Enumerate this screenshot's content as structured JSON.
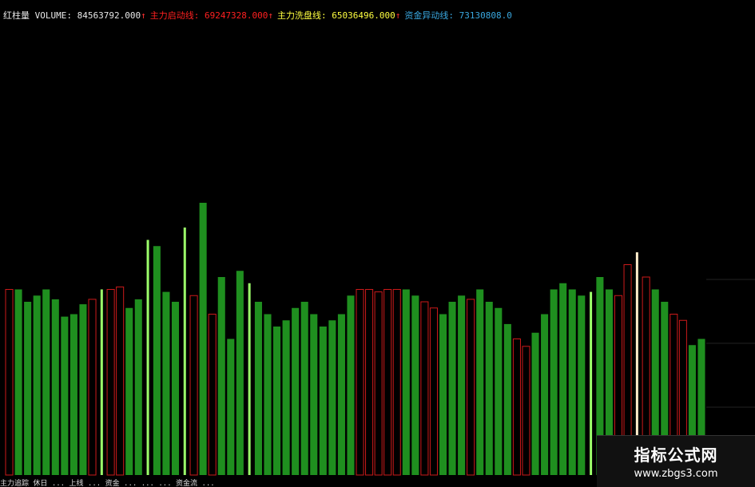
{
  "legend": [
    {
      "label": "红柱量 VOLUME: 84563792.000",
      "arrow": "↑",
      "color": "#e8e8e8"
    },
    {
      "label": "主力启动线: 69247328.000",
      "arrow": "↑",
      "color": "#ff2020"
    },
    {
      "label": "主力洗盘线: 65036496.000",
      "arrow": "↑",
      "color": "#ffff40"
    },
    {
      "label": "资金异动线: 73130808.0",
      "arrow": "",
      "color": "#3aa8e0"
    }
  ],
  "bottom_text": "主力追踪  休日 ...  上线 ...  资金 ...  ...  ...  资金流 ...",
  "watermark": {
    "title": "指标公式网",
    "url": "www.zbgs3.com"
  },
  "colors": {
    "bar_up": "#cc1a1a",
    "bar_down": "#1f8f1f",
    "bar_highlight": "#9cff6a",
    "bar_cream": "#ffeecc",
    "line_red": "#ff2020",
    "line_yellow": "#ffff40",
    "line_blue": "#3aa8e0",
    "grid": "#1a1a1a"
  },
  "chart_data": {
    "type": "bar",
    "ylim": [
      0,
      300
    ],
    "x": [
      0,
      1,
      2,
      3,
      4,
      5,
      6,
      7,
      8,
      9,
      10,
      11,
      12,
      13,
      14,
      15,
      16,
      17,
      18,
      19,
      20,
      21,
      22,
      23,
      24,
      25,
      26,
      27,
      28,
      29,
      30,
      31,
      32,
      33,
      34,
      35,
      36,
      37,
      38,
      39,
      40,
      41,
      42,
      43,
      44,
      45,
      46,
      47,
      48,
      49,
      50,
      51,
      52,
      53,
      54,
      55,
      56,
      57,
      58,
      59,
      60,
      61,
      62,
      63,
      64,
      65,
      66,
      67,
      68,
      69,
      70,
      71,
      72,
      73,
      74,
      75
    ],
    "series": [
      {
        "kind": "volume",
        "values": [
          150,
          150,
          140,
          145,
          150,
          142,
          128,
          130,
          138,
          142,
          150,
          150,
          152,
          135,
          142,
          190,
          185,
          148,
          140,
          200,
          145,
          220,
          130,
          160,
          110,
          165,
          155,
          140,
          130,
          120,
          125,
          135,
          140,
          130,
          120,
          125,
          130,
          145,
          150,
          150,
          148,
          150,
          150,
          150,
          145,
          140,
          135,
          130,
          140,
          145,
          142,
          150,
          140,
          135,
          122,
          110,
          104,
          115,
          130,
          150,
          155,
          150,
          145,
          148,
          160,
          150,
          145,
          170,
          180,
          160,
          150,
          140,
          130,
          125,
          105,
          110
        ],
        "kinds": [
          "u",
          "d",
          "d",
          "d",
          "d",
          "d",
          "d",
          "d",
          "d",
          "u",
          "h",
          "u",
          "u",
          "d",
          "d",
          "h",
          "d",
          "d",
          "d",
          "h",
          "u",
          "d",
          "u",
          "d",
          "d",
          "d",
          "h",
          "d",
          "d",
          "d",
          "d",
          "d",
          "d",
          "d",
          "d",
          "d",
          "d",
          "d",
          "u",
          "u",
          "u",
          "u",
          "u",
          "d",
          "d",
          "u",
          "u",
          "d",
          "d",
          "d",
          "u",
          "d",
          "d",
          "d",
          "d",
          "u",
          "u",
          "d",
          "d",
          "d",
          "d",
          "d",
          "d",
          "h",
          "d",
          "d",
          "u",
          "u",
          "c",
          "u",
          "d",
          "d",
          "u",
          "u",
          "d",
          "d"
        ]
      },
      {
        "name": "主力启动线",
        "values": []
      },
      {
        "name": "主力洗盘线",
        "values": []
      },
      {
        "name": "资金异动线",
        "values": []
      }
    ]
  }
}
